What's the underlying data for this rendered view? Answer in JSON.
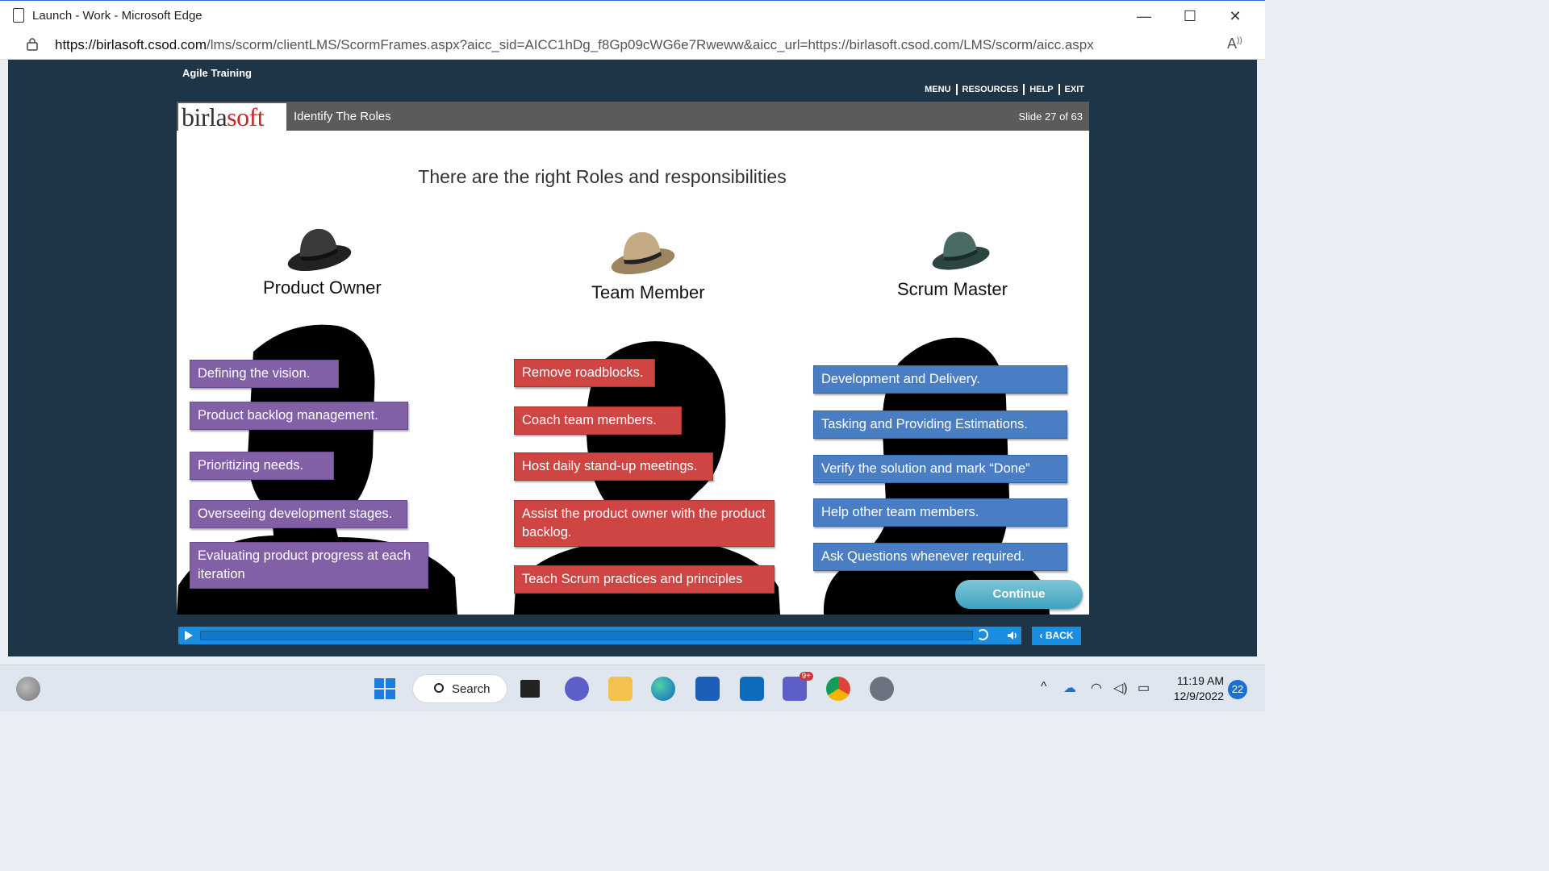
{
  "window": {
    "title": "Launch - Work - Microsoft Edge",
    "minimize": "—",
    "maximize": "☐",
    "close": "✕"
  },
  "address": {
    "url_host": "https://birlasoft.csod.com",
    "url_path": "/lms/scorm/clientLMS/ScormFrames.aspx?aicc_sid=AICC1hDg_f8Gp09cWG6e7Rweww&aicc_url=https://birlasoft.csod.com/LMS/scorm/aicc.aspx"
  },
  "lms": {
    "course_title": "Agile Training",
    "nav": [
      "MENU",
      "RESOURCES",
      "HELP",
      "EXIT"
    ]
  },
  "slide": {
    "logo_prefix": "birla",
    "logo_suffix": "soft",
    "title": "Identify The Roles",
    "counter": "Slide 27 of 63",
    "heading": "There are the right Roles and responsibilities",
    "roles": [
      {
        "name": "Product Owner",
        "hat_color": "#2b2b2b",
        "tag_color": "purple",
        "items": [
          "Defining the vision.",
          "Product backlog management.",
          "Prioritizing needs.",
          "Overseeing development stages.",
          "Evaluating product progress at each iteration"
        ]
      },
      {
        "name": "Team Member",
        "hat_color": "#b89f7a",
        "tag_color": "red",
        "items": [
          "Remove roadblocks.",
          "Coach team members.",
          "Host daily stand-up meetings.",
          "Assist the product owner with the product backlog.",
          "Teach Scrum practices and principles"
        ]
      },
      {
        "name": "Scrum Master",
        "hat_color": "#3f5f5a",
        "tag_color": "blue",
        "items": [
          "Development and Delivery.",
          "Tasking and Providing Estimations.",
          "Verify the solution and mark “Done”",
          "Help other team members.",
          "Ask Questions whenever required."
        ]
      }
    ],
    "continue_label": "Continue"
  },
  "player": {
    "back_label": "BACK",
    "back_icon": "‹"
  },
  "taskbar": {
    "search_label": "Search",
    "time": "11:19 AM",
    "date": "12/9/2022",
    "notification_count": "22",
    "teams_badge": "9+"
  }
}
